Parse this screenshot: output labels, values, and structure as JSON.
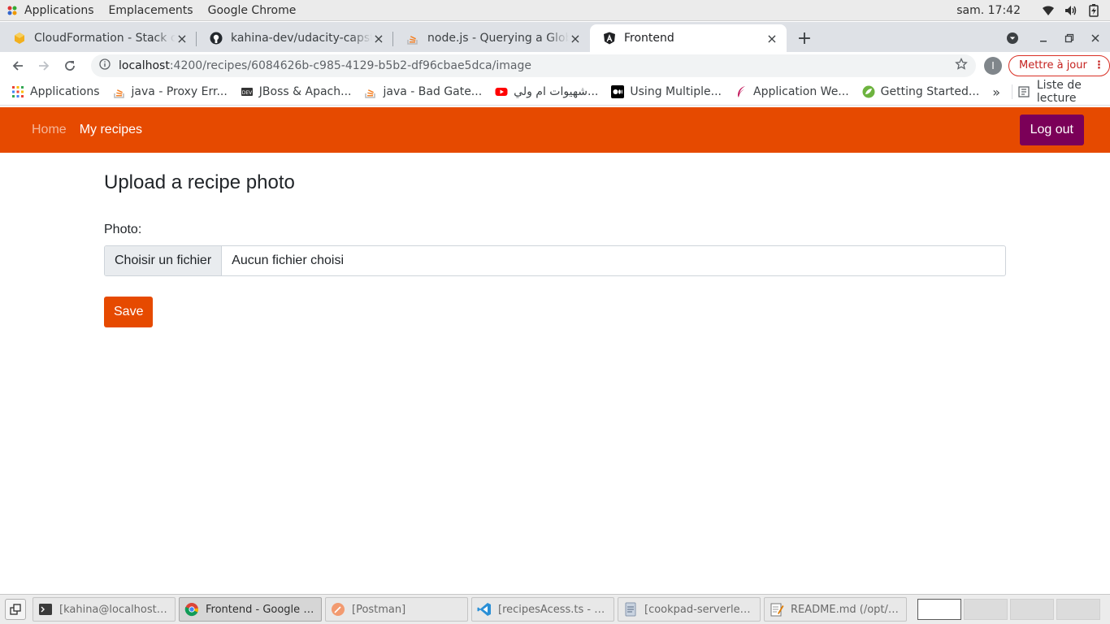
{
  "gnome": {
    "menus": [
      "Applications",
      "Emplacements",
      "Google Chrome"
    ],
    "clock": "sam. 17:42"
  },
  "tabs": [
    {
      "title": "CloudFormation - Stack co",
      "icon": "aws-icon"
    },
    {
      "title": "kahina-dev/udacity-capstone",
      "icon": "github-icon"
    },
    {
      "title": "node.js - Querying a Global",
      "icon": "stackoverflow-icon"
    },
    {
      "title": "Frontend",
      "icon": "angular-icon"
    }
  ],
  "omnibox": {
    "host": "localhost",
    "path": ":4200/recipes/6084626b-c985-4129-b5b2-df96cbae5dca/image"
  },
  "profile": {
    "initial": "I"
  },
  "update_button": {
    "label": "Mettre à jour"
  },
  "bookmarks": [
    {
      "label": "Applications",
      "icon": "apps-grid-icon"
    },
    {
      "label": "java - Proxy Err...",
      "icon": "stackoverflow-icon"
    },
    {
      "label": "JBoss & Apach...",
      "icon": "dev-icon"
    },
    {
      "label": "java - Bad Gate...",
      "icon": "stackoverflow-icon"
    },
    {
      "label": "شهيوات ام ولي...",
      "icon": "youtube-icon"
    },
    {
      "label": "Using Multiple...",
      "icon": "medium-icon"
    },
    {
      "label": "Application We...",
      "icon": "feather-icon"
    },
    {
      "label": "Getting Started...",
      "icon": "spring-icon"
    }
  ],
  "reading_list": {
    "label": "Liste de lecture"
  },
  "app_nav": {
    "home": "Home",
    "my_recipes": "My recipes",
    "logout": "Log out"
  },
  "page": {
    "title": "Upload a recipe photo",
    "photo_label": "Photo:",
    "file_button": "Choisir un fichier",
    "file_status": "Aucun fichier choisi",
    "save": "Save"
  },
  "taskbar": {
    "tasks": [
      {
        "label": "[kahina@localhost:/o...",
        "icon": "terminal-icon",
        "active": false
      },
      {
        "label": "Frontend - Google C...",
        "icon": "chrome-icon",
        "active": true
      },
      {
        "label": "[Postman]",
        "icon": "postman-icon",
        "active": false
      },
      {
        "label": "[recipesAcess.ts - bac...",
        "icon": "vscode-icon",
        "active": false
      },
      {
        "label": "[cookpad-serverless-...",
        "icon": "file-manager-icon",
        "active": false
      },
      {
        "label": "README.md (/opt/an...",
        "icon": "text-editor-icon",
        "active": false
      }
    ]
  },
  "colors": {
    "brand": "#e64a00",
    "logout": "#7b0058"
  }
}
